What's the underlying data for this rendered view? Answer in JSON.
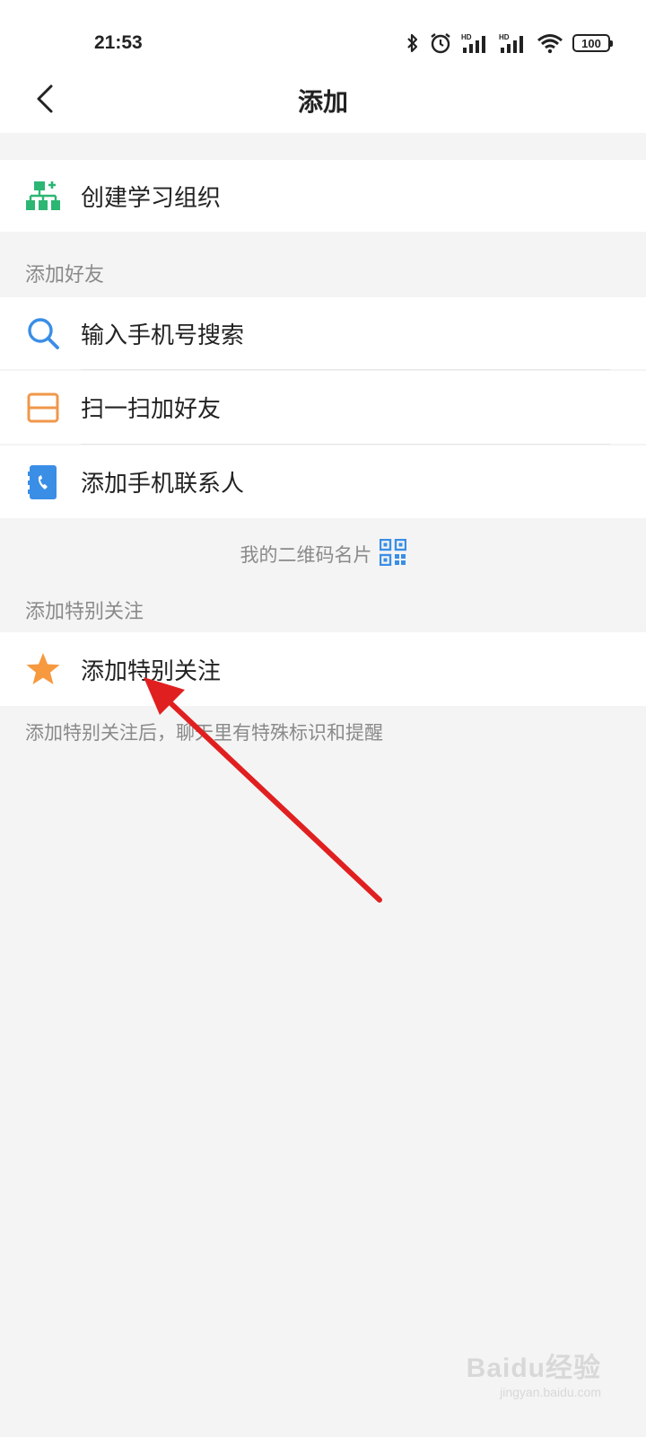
{
  "status_bar": {
    "time": "21:53",
    "battery": "100",
    "icons": [
      "bluetooth-icon",
      "alarm-icon",
      "signal-hd-icon",
      "signal-hd-icon",
      "wifi-icon",
      "battery-icon"
    ]
  },
  "header": {
    "title": "添加",
    "back_icon": "chevron-left-icon"
  },
  "create_org": {
    "label": "创建学习组织",
    "icon": "org-chart-icon",
    "icon_color": "#2bb673"
  },
  "add_friends": {
    "section_label": "添加好友",
    "items": [
      {
        "label": "输入手机号搜索",
        "icon": "search-icon",
        "icon_color": "#3a8ee6"
      },
      {
        "label": "扫一扫加好友",
        "icon": "scan-icon",
        "icon_color": "#f0974a"
      },
      {
        "label": "添加手机联系人",
        "icon": "phone-contacts-icon",
        "icon_color": "#3a8ee6"
      }
    ]
  },
  "qr_card": {
    "label": "我的二维码名片",
    "icon": "qr-code-icon",
    "icon_color": "#3a8ee6"
  },
  "special_follow": {
    "section_label": "添加特别关注",
    "item_label": "添加特别关注",
    "icon": "star-icon",
    "icon_color": "#f6993f",
    "note": "添加特别关注后，聊天里有特殊标识和提醒"
  },
  "annotation": {
    "arrow_color": "#e02020"
  },
  "watermark": {
    "main": "Baidu经验",
    "sub": "jingyan.baidu.com"
  }
}
